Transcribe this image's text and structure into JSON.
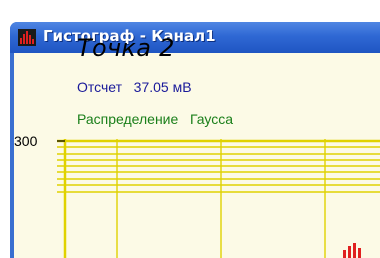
{
  "window": {
    "title": "Гистограф - Канал1",
    "icon": "histogram-app-icon"
  },
  "panel": {
    "point_title": "Точка 2",
    "reading_text": "Отсчет   37.05 мВ",
    "distribution_text": "Распределение   Гаусса"
  },
  "chart_data": {
    "type": "bar",
    "ytick_labels": [
      "300"
    ],
    "colors": {
      "grid": "#e0d200",
      "bars": "#e02020",
      "background": "#fcfae6"
    }
  }
}
